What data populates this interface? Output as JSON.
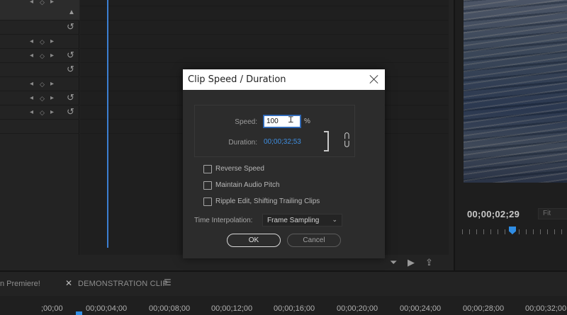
{
  "dialog": {
    "title": "Clip Speed / Duration",
    "speed_label": "Speed:",
    "speed_value": "100",
    "speed_unit": "%",
    "duration_label": "Duration:",
    "duration_value": "00;00;32;53",
    "checkboxes": [
      {
        "label": "Reverse Speed",
        "checked": false
      },
      {
        "label": "Maintain Audio Pitch",
        "checked": false
      },
      {
        "label": "Ripple Edit, Shifting Trailing Clips",
        "checked": false
      }
    ],
    "interpolation_label": "Time Interpolation:",
    "interpolation_value": "Frame Sampling",
    "ok_label": "OK",
    "cancel_label": "Cancel"
  },
  "monitor": {
    "timecode": "00;00;02;29",
    "fit_label": "Fit"
  },
  "timeline": {
    "prev_tab_label": "n Premiere!",
    "active_tab_label": "DEMONSTRATION CLIP",
    "ruler_labels": [
      ";00;00",
      "00;00;04;00",
      "00;00;08;00",
      "00;00;12;00",
      "00;00;16;00",
      "00;00;20;00",
      "00;00;24;00",
      "00;00;28;00",
      "00;00;32;00"
    ]
  },
  "icons": {
    "close": "close-icon",
    "filter": "filter-icon",
    "export": "export-icon",
    "link": "link-icon",
    "reset": "reset-icon"
  },
  "colors": {
    "accent_blue": "#3c7fd2",
    "timecode_blue": "#3f8ee0",
    "dialog_bg": "#2c2c2c",
    "panel_bg": "#232323"
  }
}
